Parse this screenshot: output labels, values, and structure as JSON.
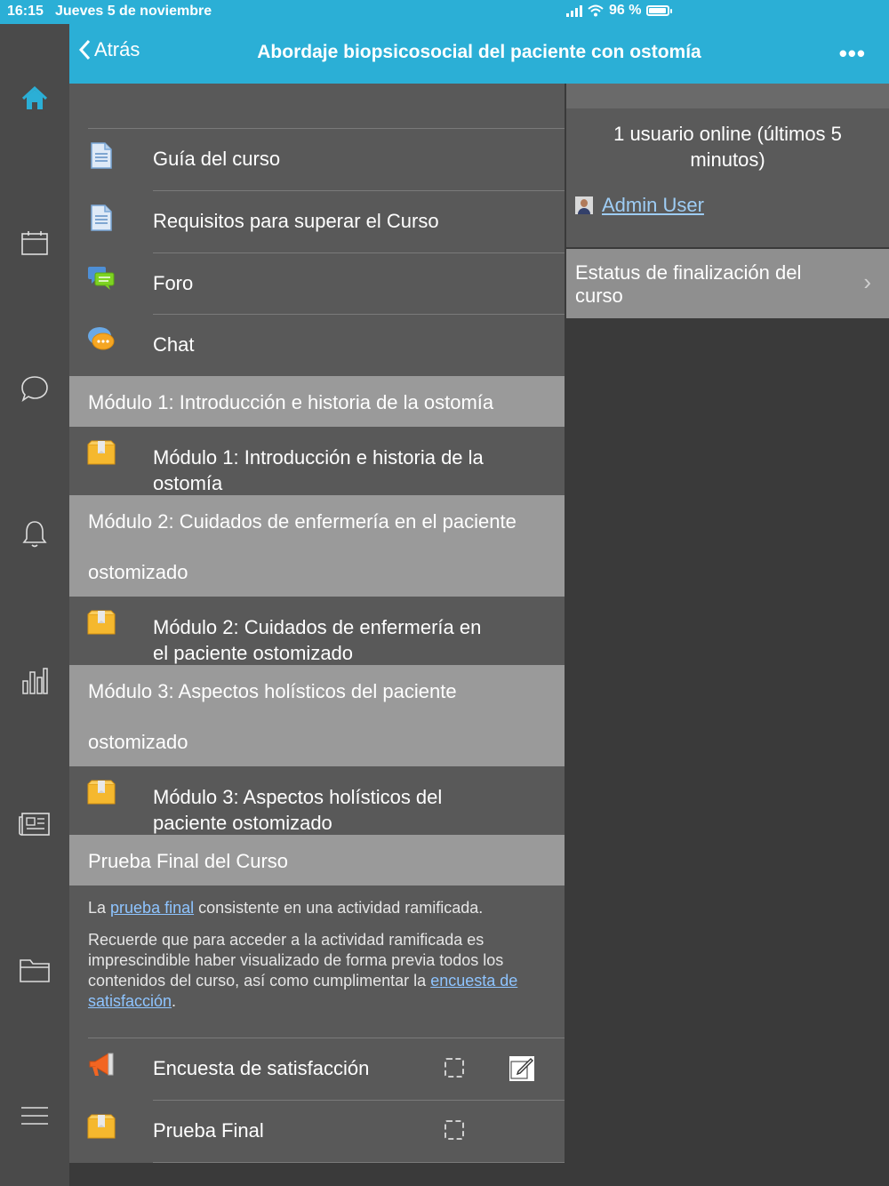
{
  "status_bar": {
    "time": "16:15",
    "date": "Jueves 5 de noviembre",
    "battery": "96 %"
  },
  "header": {
    "back_label": "Atrás",
    "title": "Abordaje biopsicosocial del paciente con ostomía",
    "more": "•••"
  },
  "sidebar": {
    "items": [
      "home-icon",
      "calendar-icon",
      "chat-bubble-icon",
      "bell-icon",
      "bar-chart-icon",
      "newspaper-icon",
      "folder-icon",
      "menu-icon"
    ],
    "active_color": "#2bafd6"
  },
  "main": {
    "top_items": [
      {
        "label": "Guía del curso",
        "icon": "document-icon"
      },
      {
        "label": "Requisitos para superar el Curso",
        "icon": "document-icon"
      },
      {
        "label": "Foro",
        "icon": "forum-icon"
      },
      {
        "label": "Chat",
        "icon": "chat-icon"
      }
    ],
    "modules": [
      {
        "section": "Módulo 1: Introducción e historia de la ostomía",
        "item": "Módulo 1: Introducción e historia de la ostomía"
      },
      {
        "section_line1": "Módulo 2: Cuidados de enfermería en el paciente",
        "section_line2": "ostomizado",
        "item_line1": "Módulo 2: Cuidados de enfermería en",
        "item_line2": "el paciente ostomizado"
      },
      {
        "section_line1": "Módulo 3: Aspectos holísticos del paciente",
        "section_line2": "ostomizado",
        "item_line1": "Módulo 3: Aspectos holísticos del",
        "item_line2": "paciente ostomizado"
      }
    ],
    "module1_item_line1": "Módulo 1: Introducción e historia de la",
    "module1_item_line2": "ostomía",
    "final_section": "Prueba Final del Curso",
    "info1": {
      "pre": "La ",
      "link": "prueba final",
      "post": " consistente en una actividad ramificada."
    },
    "info2": {
      "pre": "Recuerde que para acceder a la actividad ramificada es imprescindible haber visualizado de forma previa todos los contenidos del curso, así como cumplimentar la ",
      "link": "encuesta de satisfacción",
      "post": "."
    },
    "final_items": [
      {
        "label": "Encuesta de satisfacción",
        "icon": "megaphone-icon"
      },
      {
        "label": "Prueba Final",
        "icon": "package-icon"
      }
    ]
  },
  "right_panel": {
    "online_text": "1 usuario online (últimos 5 minutos)",
    "user": "Admin User",
    "status_label": "Estatus de finalización del curso",
    "chevron": "›"
  }
}
